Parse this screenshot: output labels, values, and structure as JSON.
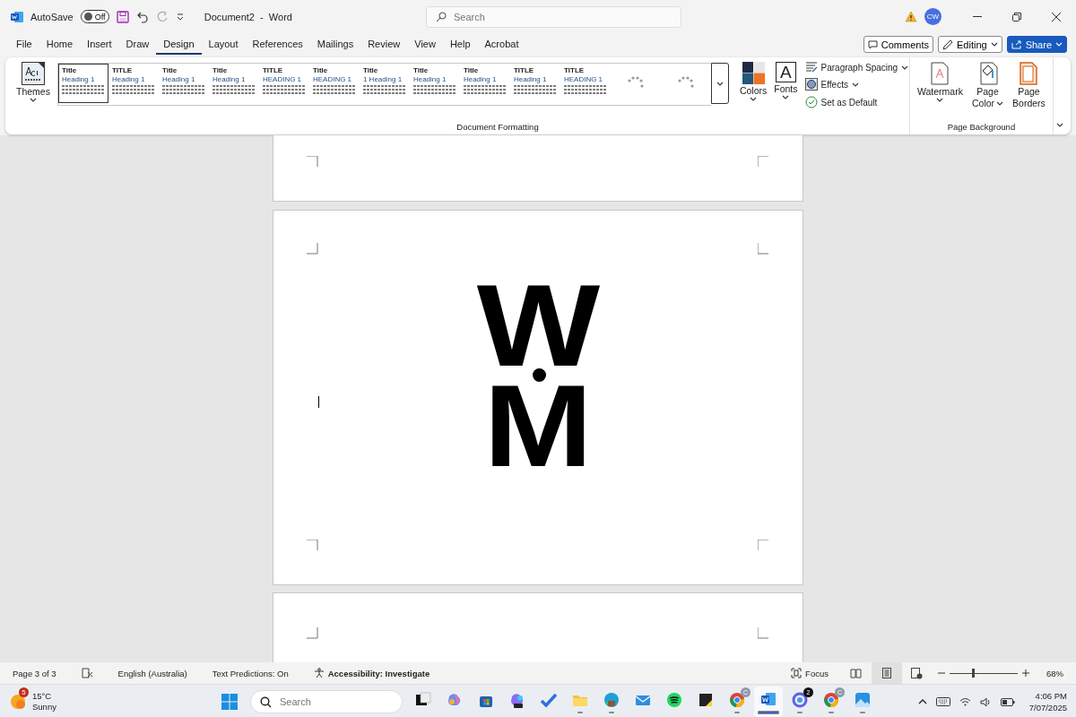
{
  "title_bar": {
    "autosave_label": "AutoSave",
    "autosave": {
      "on": false,
      "label": "Off"
    },
    "document_title": "Document2  -  Word",
    "search": {
      "placeholder": "Search"
    },
    "avatar": "CW"
  },
  "ribbon_tabs": [
    {
      "label": "File",
      "selected": false
    },
    {
      "label": "Home",
      "selected": false
    },
    {
      "label": "Insert",
      "selected": false
    },
    {
      "label": "Draw",
      "selected": false
    },
    {
      "label": "Design",
      "selected": true
    },
    {
      "label": "Layout",
      "selected": false
    },
    {
      "label": "References",
      "selected": false
    },
    {
      "label": "Mailings",
      "selected": false
    },
    {
      "label": "Review",
      "selected": false
    },
    {
      "label": "View",
      "selected": false
    },
    {
      "label": "Help",
      "selected": false
    },
    {
      "label": "Acrobat",
      "selected": false
    }
  ],
  "actions": [
    {
      "label": "Comments",
      "kind": "comments"
    },
    {
      "label": "Editing",
      "kind": "editing"
    },
    {
      "label": "Share",
      "kind": "share"
    }
  ],
  "ribbon": {
    "themes_label": "Themes",
    "gallery": [
      {
        "kind": "style",
        "title": "Title",
        "heading": "Heading 1",
        "selected": true
      },
      {
        "kind": "style",
        "title": "TITLE",
        "heading": "Heading 1",
        "selected": false
      },
      {
        "kind": "style",
        "title": "Title",
        "heading": "Heading 1",
        "selected": false
      },
      {
        "kind": "style",
        "title": "Title",
        "heading": "Heading 1",
        "selected": false
      },
      {
        "kind": "style",
        "title": "TITLE",
        "heading": "HEADING 1",
        "selected": false
      },
      {
        "kind": "style",
        "title": "Title",
        "heading": "HEADING 1",
        "selected": false
      },
      {
        "kind": "style",
        "title": "Title",
        "heading": "1 Heading 1",
        "selected": false
      },
      {
        "kind": "style",
        "title": "Title",
        "heading": "Heading 1",
        "selected": false
      },
      {
        "kind": "style",
        "title": "Title",
        "heading": "Heading 1",
        "selected": false
      },
      {
        "kind": "style",
        "title": "TITLE",
        "heading": "Heading 1",
        "selected": false
      },
      {
        "kind": "style",
        "title": "TITLE",
        "heading": "HEADING 1",
        "selected": false
      },
      {
        "kind": "loading"
      },
      {
        "kind": "loading"
      }
    ],
    "colors_label": "Colors",
    "fonts_label": "Fonts",
    "fonts_glyph": "A",
    "paragraph_spacing": "Paragraph Spacing",
    "effects": "Effects",
    "set_default": "Set as Default",
    "formatting_group": "Document Formatting",
    "watermark": "Watermark",
    "page_color": "Page Color",
    "page_borders": "Page Borders",
    "background_group": "Page Background"
  },
  "document": {
    "pages": [
      {
        "kind": "cut_top"
      },
      {
        "kind": "logo",
        "letters": [
          "W",
          "M"
        ]
      },
      {
        "kind": "cut_bottom"
      }
    ]
  },
  "status_bar": {
    "page": "Page 3 of 3",
    "language": "English (Australia)",
    "predictions": "Text Predictions: On",
    "accessibility": "Accessibility: Investigate",
    "focus": "Focus",
    "views": [
      {
        "kind": "read",
        "selected": false
      },
      {
        "kind": "print",
        "selected": true
      },
      {
        "kind": "web",
        "selected": false
      }
    ],
    "zoom": {
      "level": 0.33,
      "reading": "68%"
    }
  },
  "taskbar": {
    "weather": {
      "badge": "5",
      "temp": "15°C",
      "condition": "Sunny"
    },
    "search": {
      "placeholder": "Search"
    },
    "apps": [
      {
        "kind": "tasks",
        "running": false,
        "active": false
      },
      {
        "kind": "copilot",
        "running": false,
        "active": false
      },
      {
        "kind": "store",
        "running": false,
        "active": false
      },
      {
        "kind": "m365",
        "running": false,
        "active": false
      },
      {
        "kind": "todo",
        "running": false,
        "active": false
      },
      {
        "kind": "folder",
        "running": true,
        "active": false
      },
      {
        "kind": "edge",
        "running": true,
        "active": false
      },
      {
        "kind": "mail",
        "running": false,
        "active": false
      },
      {
        "kind": "spotify",
        "running": false,
        "active": false
      },
      {
        "kind": "notes",
        "running": false,
        "active": false
      },
      {
        "kind": "chrome",
        "running": true,
        "active": false,
        "badge": "C"
      },
      {
        "kind": "word",
        "running": true,
        "active": true
      },
      {
        "kind": "ring",
        "running": true,
        "active": false,
        "badge": "2"
      },
      {
        "kind": "chrome",
        "running": true,
        "active": false,
        "badge": "C"
      },
      {
        "kind": "photos",
        "running": true,
        "active": false
      }
    ],
    "clock": {
      "time": "4:06 PM",
      "date": "7/07/2025"
    }
  }
}
